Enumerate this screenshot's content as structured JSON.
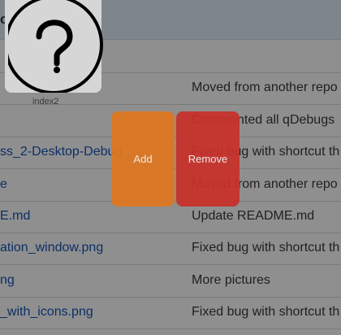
{
  "header": {
    "title_fragment": "cl"
  },
  "files": [
    {
      "name": "",
      "commit": "Moved from another repo"
    },
    {
      "name": "",
      "commit": "Commented all qDebugs"
    },
    {
      "name": "ss_2-Desktop-Debug",
      "commit": "Fixed bug with shortcut th"
    },
    {
      "name": "e",
      "commit": "Moved from another repo"
    },
    {
      "name": "E.md",
      "commit": "Update README.md"
    },
    {
      "name": "ation_window.png",
      "commit": "Fixed bug with shortcut th"
    },
    {
      "name": "ng",
      "commit": "More pictures"
    },
    {
      "name": "_with_icons.png",
      "commit": "Fixed bug with shortcut th"
    }
  ],
  "thumbnail": {
    "icon": "question-mark-icon",
    "label": "index2"
  },
  "actions": {
    "add_label": "Add",
    "remove_label": "Remove"
  },
  "colors": {
    "add": "#e0781f",
    "remove": "#c9302a",
    "overlay": "#8f8f8f"
  }
}
